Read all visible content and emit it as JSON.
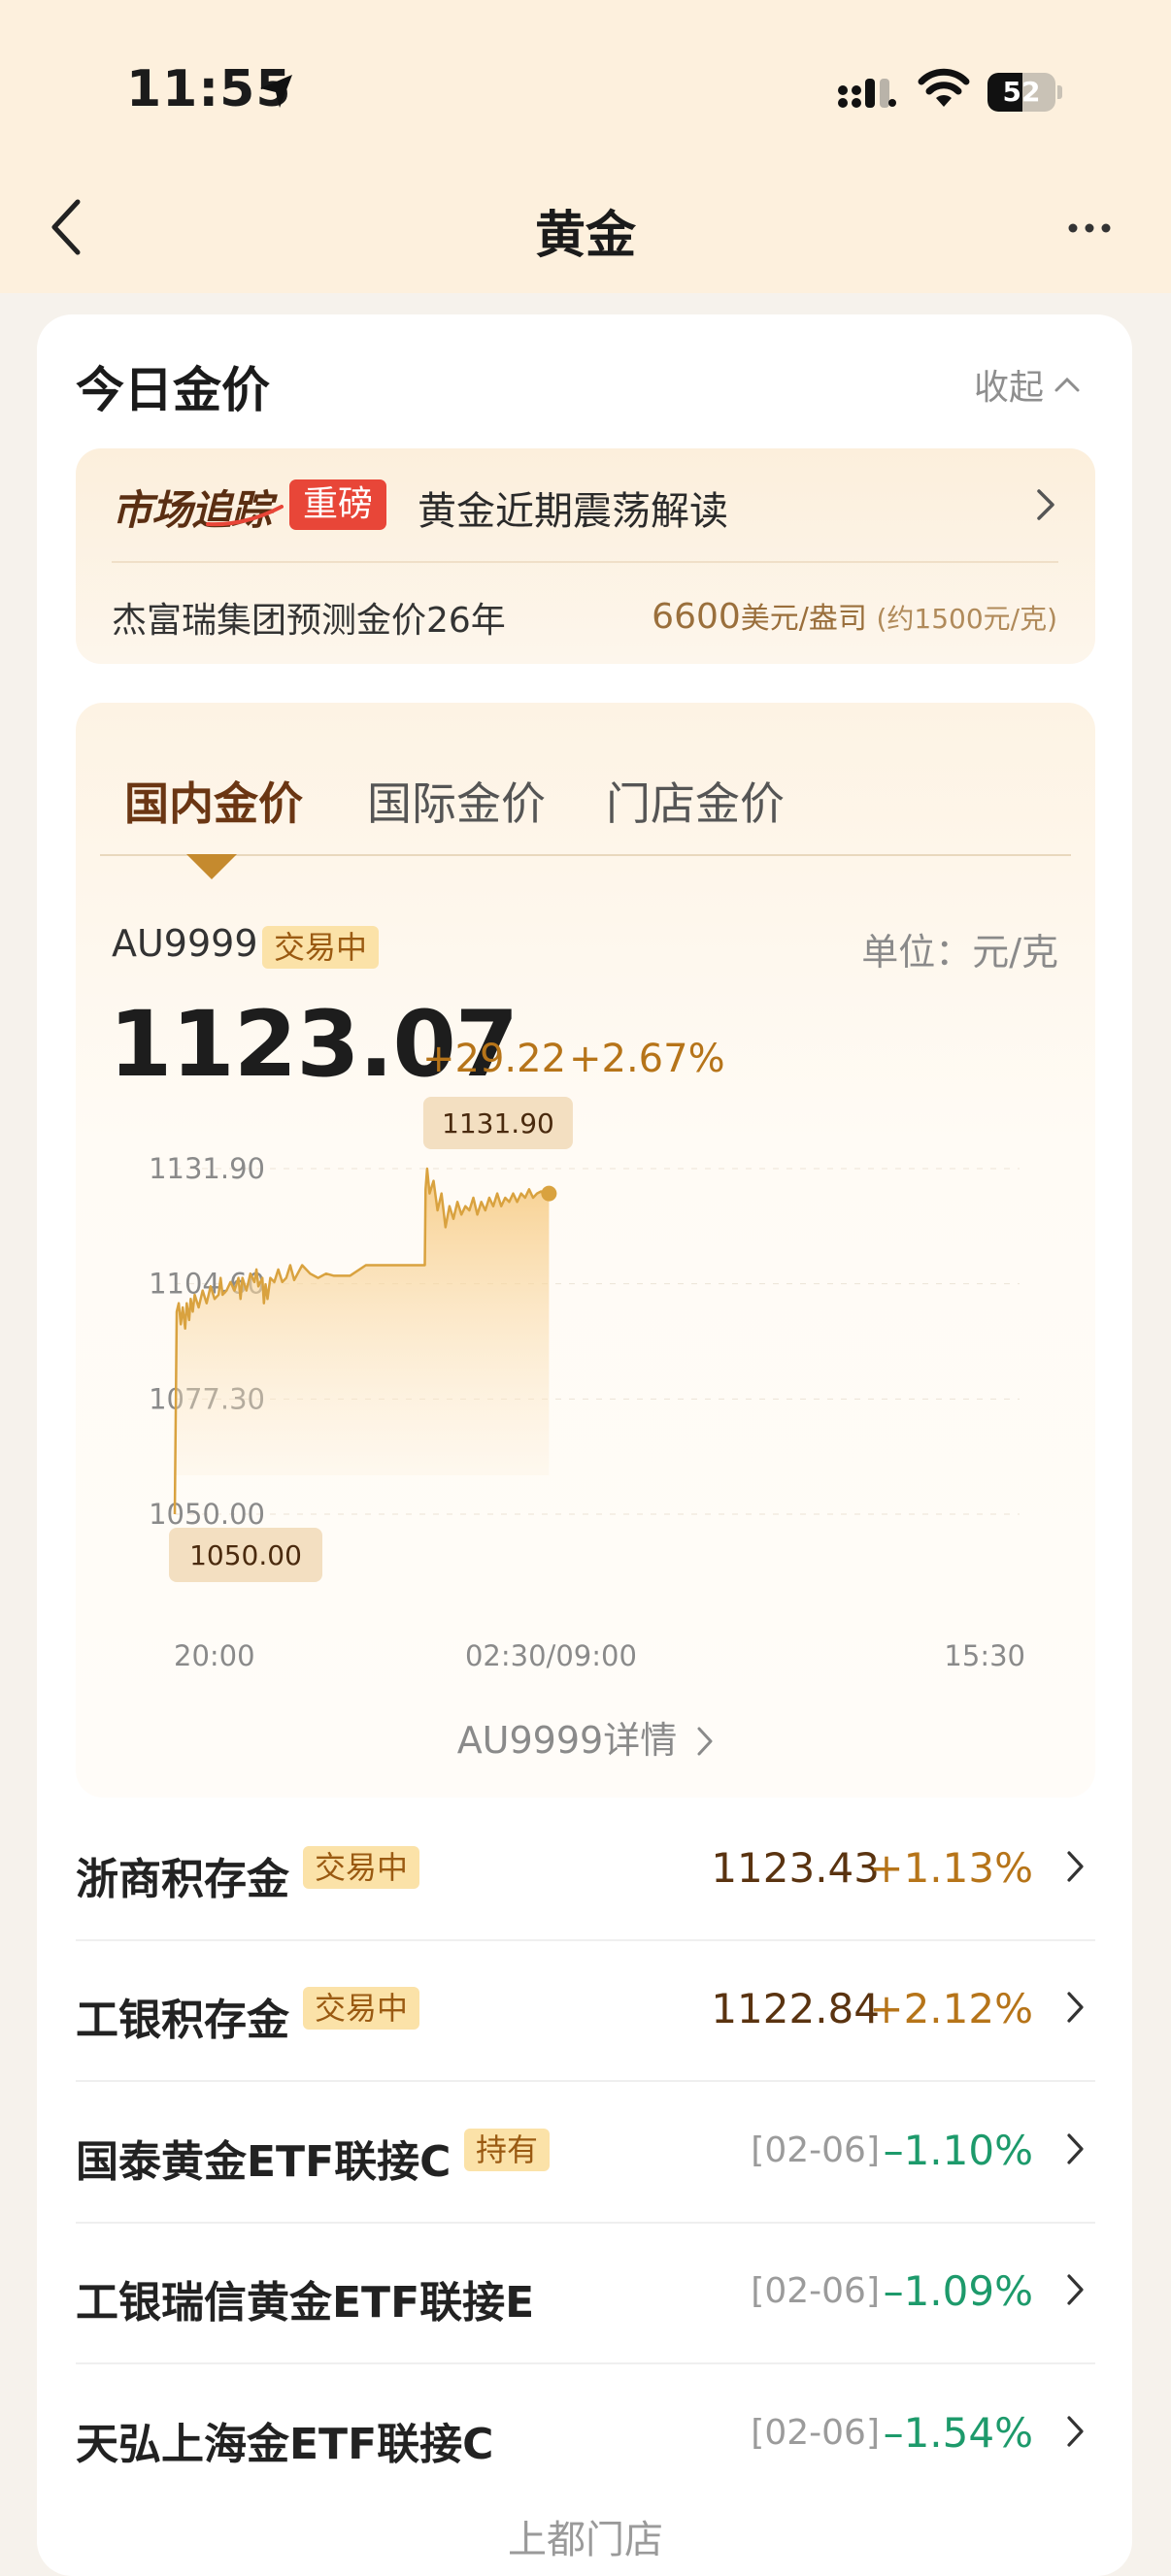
{
  "status_bar": {
    "time": "11:55",
    "battery": "52",
    "battery_level": 0.52
  },
  "nav": {
    "title": "黄金"
  },
  "section": {
    "title": "今日金价",
    "collapse_label": "收起"
  },
  "news": {
    "brand": "市场追踪",
    "tag": "重磅",
    "headline": "黄金近期震荡解读",
    "sub_text": "杰富瑞集团预测金价26年",
    "figure_value": "6600",
    "figure_unit": "美元/盎司",
    "figure_note": "(约1500元/克)"
  },
  "tabs": [
    {
      "label": "国内金价",
      "active": true
    },
    {
      "label": "国际金价",
      "active": false
    },
    {
      "label": "门店金价",
      "active": false
    }
  ],
  "quote": {
    "code": "AU9999",
    "status": "交易中",
    "unit": "单位：元/克",
    "price": "1123.07",
    "change_abs": "+29.22",
    "change_pct": "+2.67%",
    "detail_link": "AU9999详情"
  },
  "chart_data": {
    "type": "area",
    "y_ticks": [
      "1131.90",
      "1104.60",
      "1077.30",
      "1050.00"
    ],
    "x_ticks": [
      "20:00",
      "02:30/09:00",
      "15:30"
    ],
    "ylim": [
      1050.0,
      1131.9
    ],
    "high_label": "1131.90",
    "low_label": "1050.00",
    "color": "#d9a23f",
    "x": [
      0,
      0.5,
      1,
      1.5,
      2,
      2.6,
      3,
      3.6,
      4,
      4.5,
      5,
      6,
      7,
      8,
      9,
      10,
      11,
      11.5,
      12,
      13,
      14,
      15,
      16,
      16.5,
      17,
      18,
      19,
      20,
      20.5,
      21,
      22,
      22.4,
      22.8,
      23.3,
      24,
      25,
      26,
      27,
      28,
      29,
      30,
      32,
      34,
      36,
      38,
      40,
      42,
      44,
      48,
      52,
      56,
      60,
      62.8,
      63,
      63.4,
      64,
      65,
      66,
      67,
      68,
      69,
      70,
      71,
      72,
      73,
      74,
      75,
      76,
      77,
      78,
      79,
      80,
      81,
      82,
      83,
      84,
      85,
      86,
      87,
      88,
      89,
      90,
      91,
      92,
      93,
      94
    ],
    "y": [
      1050.0,
      1098.0,
      1100.0,
      1095.0,
      1099.0,
      1094.0,
      1100.0,
      1096.0,
      1101.0,
      1098.0,
      1102.0,
      1099.0,
      1103.0,
      1100.0,
      1104.0,
      1101.0,
      1102.0,
      1106.0,
      1102.0,
      1103.0,
      1105.0,
      1103.0,
      1106.0,
      1101.0,
      1106.0,
      1103.0,
      1107.0,
      1105.0,
      1108.0,
      1104.0,
      1106.0,
      1100.0,
      1104.5,
      1101.0,
      1106.0,
      1105.0,
      1108.0,
      1105.0,
      1106.0,
      1109.0,
      1105.5,
      1109.0,
      1107.0,
      1106.0,
      1107.0,
      1106.5,
      1106.5,
      1106.5,
      1109.0,
      1109.0,
      1109.0,
      1109.0,
      1109.0,
      1127.0,
      1131.9,
      1126.0,
      1129.0,
      1122.0,
      1126.0,
      1118.0,
      1123.0,
      1120.0,
      1124.0,
      1121.0,
      1123.0,
      1122.0,
      1125.0,
      1121.0,
      1124.0,
      1122.0,
      1125.0,
      1123.0,
      1126.0,
      1123.0,
      1125.0,
      1124.0,
      1126.0,
      1124.0,
      1126.0,
      1125.0,
      1127.0,
      1125.0,
      1126.0,
      1126.5,
      1125.5,
      1126.0
    ]
  },
  "funds": [
    {
      "name": "浙商积存金",
      "chip": "交易中",
      "price": "1123.43",
      "date": "",
      "change": "+1.13%",
      "dir": "up"
    },
    {
      "name": "工银积存金",
      "chip": "交易中",
      "price": "1122.84",
      "date": "",
      "change": "+2.12%",
      "dir": "up"
    },
    {
      "name": "国泰黄金ETF联接C",
      "chip": "持有",
      "price": "",
      "date": "[02-06]",
      "change": "–1.10%",
      "dir": "down"
    },
    {
      "name": "工银瑞信黄金ETF联接E",
      "chip": "",
      "price": "",
      "date": "[02-06]",
      "change": "–1.09%",
      "dir": "down"
    },
    {
      "name": "天弘上海金ETF联接C",
      "chip": "",
      "price": "",
      "date": "[02-06]",
      "change": "–1.54%",
      "dir": "down"
    }
  ],
  "more_funds_label": "上都门店"
}
